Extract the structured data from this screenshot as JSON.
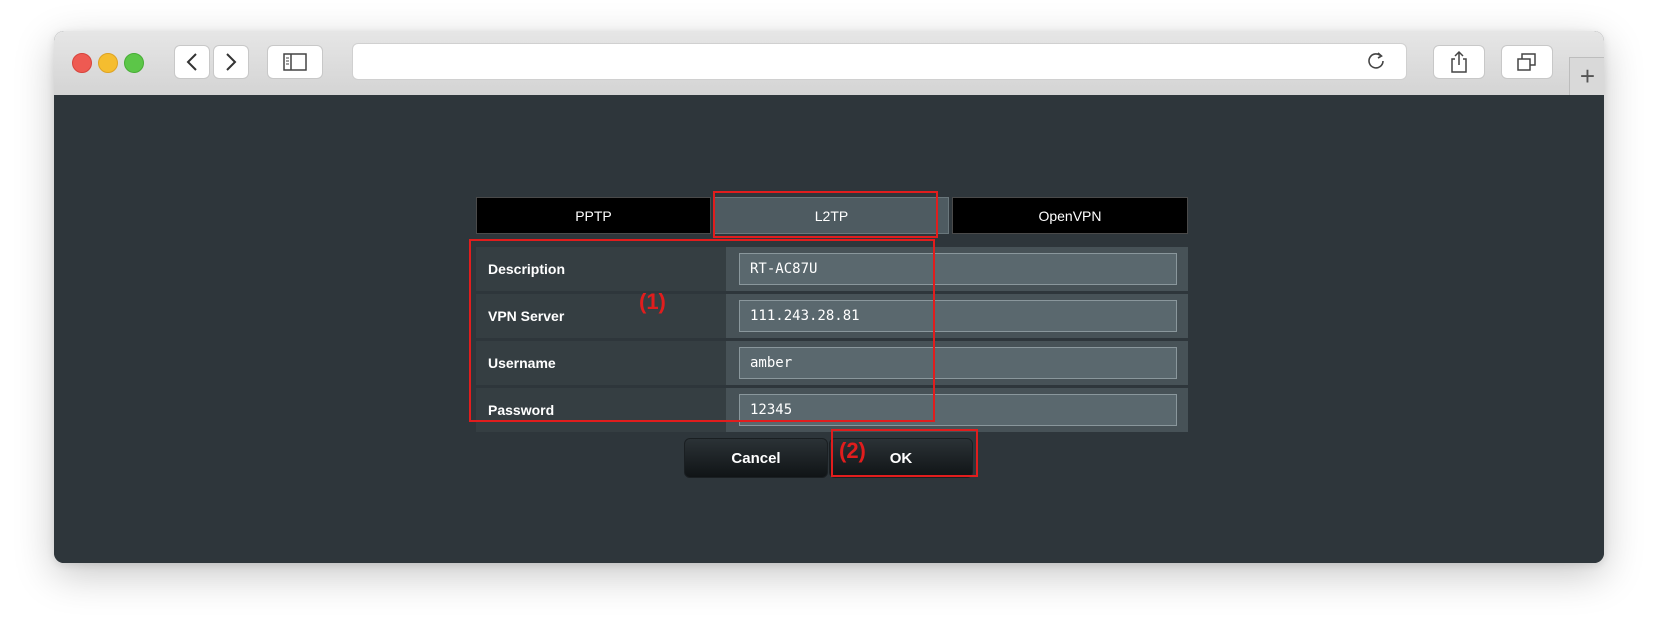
{
  "browser": {
    "address": "",
    "new_tab_symbol": "+"
  },
  "tabs": [
    {
      "label": "PPTP"
    },
    {
      "label": "L2TP"
    },
    {
      "label": "OpenVPN"
    }
  ],
  "form": {
    "rows": [
      {
        "label": "Description",
        "value": "RT-AC87U"
      },
      {
        "label": "VPN Server",
        "value": "111.243.28.81"
      },
      {
        "label": "Username",
        "value": "amber"
      },
      {
        "label": "Password",
        "value": "12345"
      }
    ]
  },
  "buttons": {
    "cancel": "Cancel",
    "ok": "OK"
  },
  "annotations": {
    "one": "(1)",
    "two": "(2)"
  },
  "colors": {
    "highlight": "#e11d1d",
    "background": "#2e363b",
    "active_tab": "#4e5b61"
  }
}
